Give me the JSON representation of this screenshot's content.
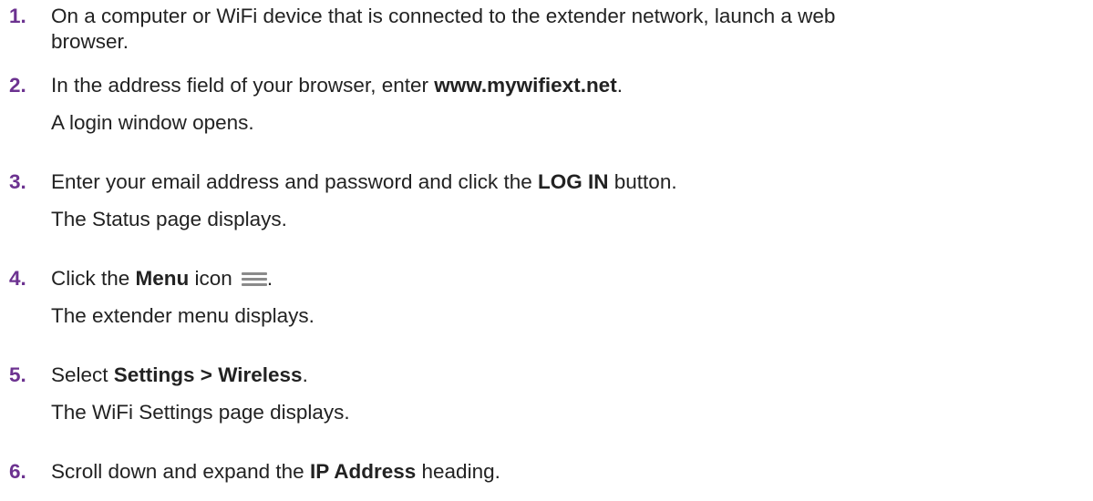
{
  "steps": [
    {
      "number": "1.",
      "text_a": "On a computer or WiFi device that is connected to the extender network, launch a web",
      "text_b": "browser."
    },
    {
      "number": "2.",
      "before": "In the address field of your browser, enter ",
      "bold": "www.mywifiext.net",
      "after": ".",
      "note": "A login window opens."
    },
    {
      "number": "3.",
      "before": "Enter your email address and password and click the ",
      "bold": "LOG IN",
      "after": " button.",
      "note": "The Status page displays."
    },
    {
      "number": "4.",
      "before": "Click the ",
      "bold": "Menu",
      "after": " icon",
      "icon": "menu-icon",
      "suffix": ".",
      "note": "The extender menu displays."
    },
    {
      "number": "5.",
      "before": "Select ",
      "bold": "Settings > Wireless",
      "after": ".",
      "note": "The WiFi Settings page displays."
    },
    {
      "number": "6.",
      "before": "Scroll down and expand the ",
      "bold": "IP Address",
      "after": " heading."
    }
  ],
  "colors": {
    "step_number": "#6c3290",
    "body_text": "#222222",
    "icon": "#8a8a8a"
  }
}
